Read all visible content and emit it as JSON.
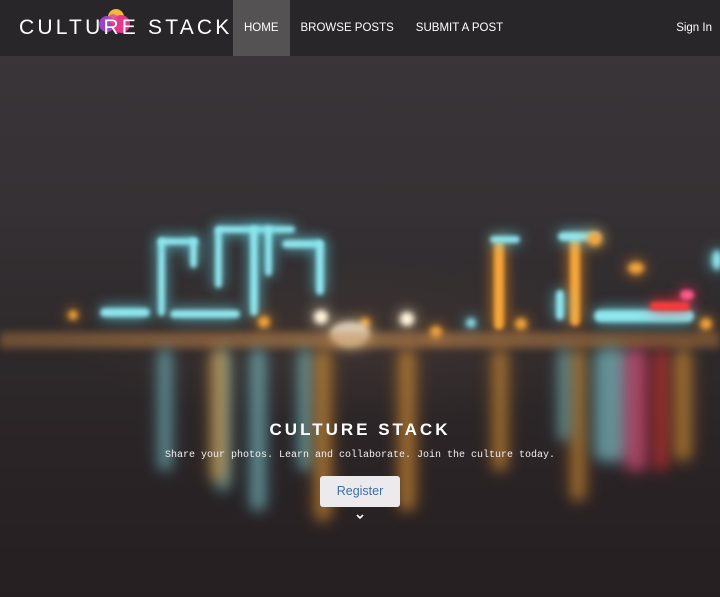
{
  "navbar": {
    "brand": "CULTURE STACK",
    "links": [
      {
        "label": "HOME",
        "active": true
      },
      {
        "label": "BROWSE POSTS",
        "active": false
      },
      {
        "label": "SUBMIT A POST",
        "active": false
      }
    ],
    "signin": "Sign In"
  },
  "hero": {
    "title": "CULTURE STACK",
    "tagline": "Share your photos. Learn and collaborate. Join the culture today.",
    "register_label": "Register"
  },
  "icons": {
    "logo": "overlapping-circles-logo-icon",
    "scroll": "chevron-down-icon"
  },
  "colors": {
    "navbar_bg": "#282528",
    "active_tab": "#555254",
    "button_bg": "#eceaec",
    "button_text": "#3d6ea8"
  }
}
